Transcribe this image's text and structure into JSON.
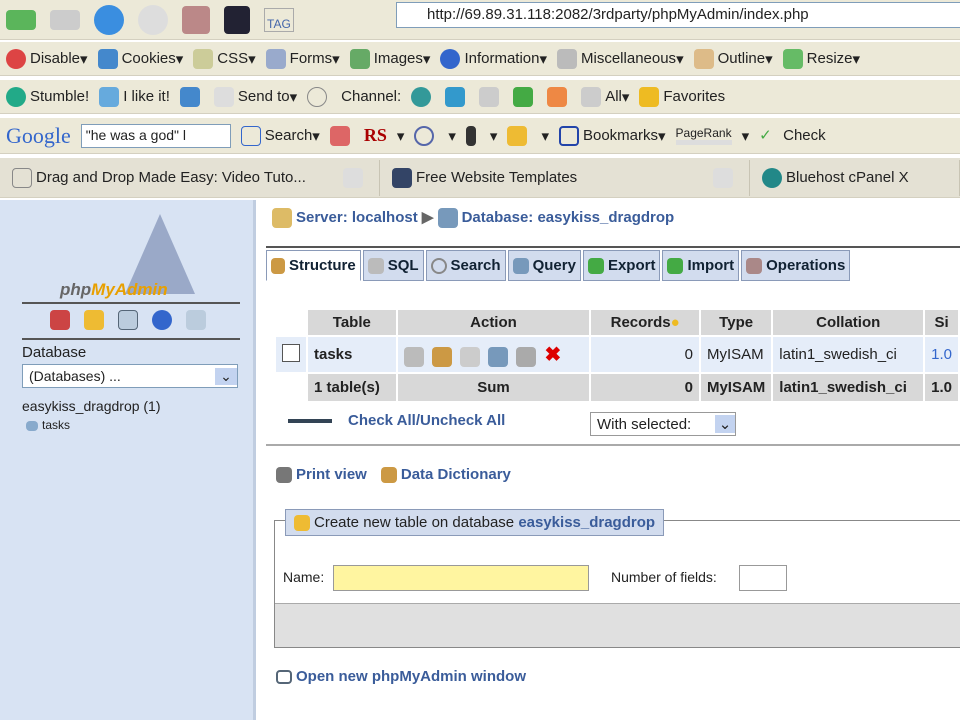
{
  "browser": {
    "url": "http://69.89.31.118:2082/3rdparty/phpMyAdmin/index.php",
    "tag_label": "TAG",
    "webdev": [
      "Disable",
      "Cookies",
      "CSS",
      "Forms",
      "Images",
      "Information",
      "Miscellaneous",
      "Outline",
      "Resize"
    ],
    "stumble": [
      "Stumble!",
      "I like it!",
      "Send to",
      "Channel:",
      "All",
      "Favorites"
    ],
    "google": {
      "logo": "Google",
      "query": "\"he was a god\" l",
      "search": "Search",
      "rs": "RS",
      "bookmarks": "Bookmarks",
      "pagerank": "PageRank",
      "check": "Check"
    },
    "tabs": [
      "Drag and Drop Made Easy: Video Tuto...",
      "Free Website Templates",
      "Bluehost cPanel X"
    ]
  },
  "sidebar": {
    "logo_php": "php",
    "logo_my": "MyAdmin",
    "db_label": "Database",
    "db_select": "(Databases) ...",
    "db_name": "easykiss_dragdrop (1)",
    "table": "tasks"
  },
  "main": {
    "server": "Server: localhost",
    "database": "Database: easykiss_dragdrop",
    "tabs": [
      "Structure",
      "SQL",
      "Search",
      "Query",
      "Export",
      "Import",
      "Operations"
    ],
    "headers": [
      "Table",
      "Action",
      "Records",
      "Type",
      "Collation",
      "Si"
    ],
    "row": {
      "name": "tasks",
      "records": "0",
      "type": "MyISAM",
      "collation": "latin1_swedish_ci",
      "size": "1.0"
    },
    "sum": {
      "label": "1 table(s)",
      "sum": "Sum",
      "records": "0",
      "type": "MyISAM",
      "collation": "latin1_swedish_ci",
      "size": "1.0"
    },
    "check_all": "Check All",
    "uncheck_all": "Uncheck All",
    "sep": " / ",
    "with_selected": "With selected:",
    "print_view": "Print view",
    "data_dict": "Data Dictionary",
    "create_prefix": "Create new table on database ",
    "create_db": "easykiss_dragdrop",
    "name_label": "Name:",
    "fields_label": "Number of fields:",
    "open_new": "Open new phpMyAdmin window"
  }
}
